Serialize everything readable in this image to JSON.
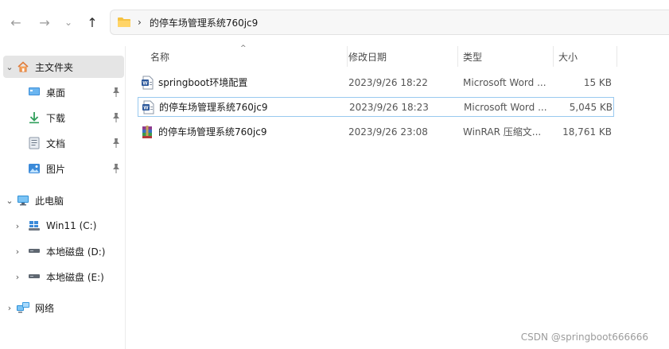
{
  "address": {
    "path": "的停车场管理系统760jc9",
    "chevron": "›"
  },
  "nav": {
    "back_icon": "←",
    "forward_icon": "→",
    "recent_icon": "⌄",
    "up_icon": "↑"
  },
  "sidebar": {
    "items": [
      {
        "label": "主文件夹",
        "chevron": "⌄",
        "icon": "home-icon"
      },
      {
        "label": "桌面",
        "icon": "desktop-icon",
        "pinned": true
      },
      {
        "label": "下载",
        "icon": "download-icon",
        "pinned": true
      },
      {
        "label": "文档",
        "icon": "documents-icon",
        "pinned": true
      },
      {
        "label": "图片",
        "icon": "pictures-icon",
        "pinned": true
      },
      {
        "label": "此电脑",
        "chevron": "⌄",
        "icon": "computer-icon"
      },
      {
        "label": "Win11 (C:)",
        "chevron": "›",
        "icon": "windows-drive-icon"
      },
      {
        "label": "本地磁盘 (D:)",
        "chevron": "›",
        "icon": "drive-icon"
      },
      {
        "label": "本地磁盘 (E:)",
        "chevron": "›",
        "icon": "drive-icon"
      },
      {
        "label": "网络",
        "chevron": "›",
        "icon": "network-icon"
      }
    ]
  },
  "columns": {
    "name": "名称",
    "date": "修改日期",
    "type": "类型",
    "size": "大小",
    "sort_indicator": "^"
  },
  "files": [
    {
      "name": "springboot环境配置",
      "date": "2023/9/26 18:22",
      "type": "Microsoft Word ...",
      "size": "15 KB",
      "icon": "word-icon"
    },
    {
      "name": "的停车场管理系统760jc9",
      "date": "2023/9/26 18:23",
      "type": "Microsoft Word ...",
      "size": "5,045 KB",
      "icon": "word-icon",
      "selected": true
    },
    {
      "name": "的停车场管理系统760jc9",
      "date": "2023/9/26 23:08",
      "type": "WinRAR 压缩文...",
      "size": "18,761 KB",
      "icon": "winrar-icon"
    }
  ],
  "watermark": "CSDN @springboot666666",
  "colors": {
    "selection_border": "#99c9ef",
    "folder": "#f5c242",
    "word_blue": "#2b579a"
  }
}
